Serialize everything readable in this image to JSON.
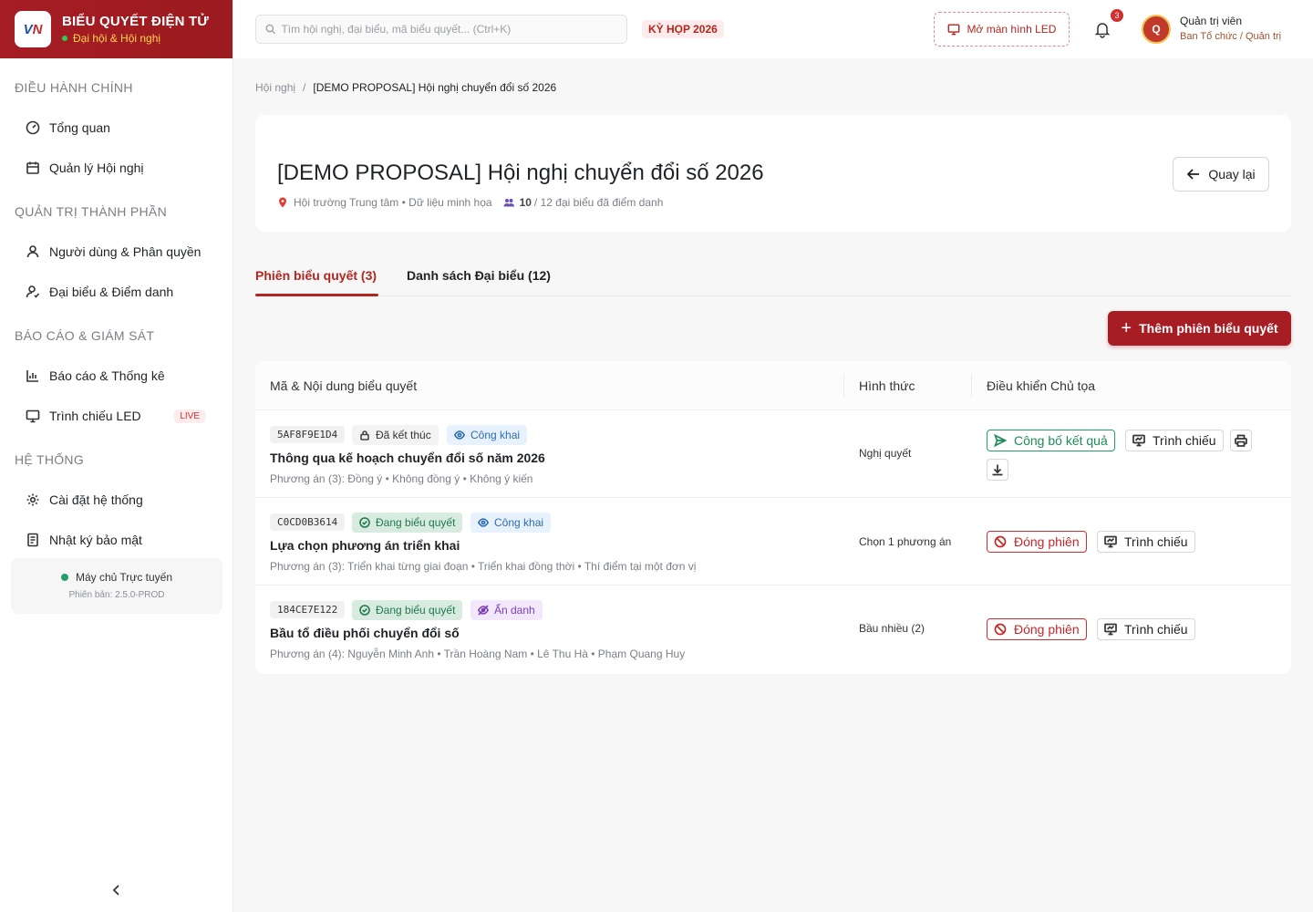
{
  "app": {
    "title": "BIỂU QUYẾT ĐIỆN TỬ",
    "subtitle": "Đại hội & Hội nghị",
    "logo_text_blue": "V",
    "logo_text_red": "N"
  },
  "sidebar": {
    "sections": [
      {
        "title": "ĐIỀU HÀNH CHÍNH",
        "items": [
          {
            "label": "Tổng quan",
            "icon": "dashboard-icon"
          },
          {
            "label": "Quản lý Hội nghị",
            "icon": "calendar-icon"
          }
        ]
      },
      {
        "title": "QUẢN TRỊ THÀNH PHẦN",
        "items": [
          {
            "label": "Người dùng & Phân quyền",
            "icon": "users-icon"
          },
          {
            "label": "Đại biểu & Điểm danh",
            "icon": "user-check-icon"
          }
        ]
      },
      {
        "title": "BÁO CÁO & GIÁM SÁT",
        "items": [
          {
            "label": "Báo cáo & Thống kê",
            "icon": "bar-chart-icon"
          },
          {
            "label": "Trình chiếu LED",
            "icon": "monitor-icon",
            "badge": "LIVE"
          }
        ]
      },
      {
        "title": "HỆ THỐNG",
        "items": [
          {
            "label": "Cài đặt hệ thống",
            "icon": "gear-icon"
          },
          {
            "label": "Nhật ký bảo mật",
            "icon": "log-icon"
          }
        ]
      }
    ],
    "server_status": "Máy chủ Trực tuyến",
    "version": "Phiên bản: 2.5.0-PROD"
  },
  "topbar": {
    "search_placeholder": "Tìm hội nghị, đại biểu, mã biểu quyết... (Ctrl+K)",
    "session_badge": "KỲ HỌP 2026",
    "led_button": "Mở màn hình LED",
    "notification_count": "3",
    "avatar_letter": "Q",
    "user_name": "Quản trị viên",
    "user_role": "Ban Tổ chức / Quản trị"
  },
  "breadcrumb": {
    "parent": "Hội nghị",
    "separator": "/",
    "current": "[DEMO PROPOSAL] Hội nghị chuyển đổi số 2026"
  },
  "conference": {
    "title": "[DEMO PROPOSAL] Hội nghị chuyển đổi số 2026",
    "location": "Hội trường Trung tâm • Dữ liệu minh họa",
    "attended": "10",
    "attendance_rest": "/ 12 đại biểu đã điểm danh",
    "back_button": "Quay lại"
  },
  "tabs": [
    {
      "label": "Phiên biểu quyết (3)",
      "active": true
    },
    {
      "label": "Danh sách Đại biểu (12)",
      "active": false
    }
  ],
  "add_button": "Thêm phiên biểu quyết",
  "table": {
    "headers": [
      "Mã & Nội dung biểu quyết",
      "Hình thức",
      "Điều khiển Chủ tọa"
    ],
    "rows": [
      {
        "code": "5AF8F9E1D4",
        "status": "Đã kết thúc",
        "visibility": "Công khai",
        "title": "Thông qua kế hoạch chuyển đổi số năm 2026",
        "options": "Phương án (3): Đồng ý • Không đồng ý • Không ý kiến",
        "form": "Nghị quyết",
        "controls": [
          "Công bố kết quả",
          "Trình chiếu"
        ]
      },
      {
        "code": "C0CD0B3614",
        "status": "Đang biểu quyết",
        "visibility": "Công khai",
        "title": "Lựa chọn phương án triển khai",
        "options": "Phương án (3): Triển khai từng giai đoạn • Triển khai đồng thời • Thí điểm tại một đơn vị",
        "form": "Chọn 1 phương án",
        "controls": [
          "Đóng phiên",
          "Trình chiếu"
        ]
      },
      {
        "code": "184CE7E122",
        "status": "Đang biểu quyết",
        "visibility": "Ẩn danh",
        "title": "Bầu tổ điều phối chuyển đổi số",
        "options": "Phương án (4): Nguyễn Minh Anh • Trần Hoàng Nam • Lê Thu Hà • Phạm Quang Huy",
        "form": "Bầu nhiều (2)",
        "controls": [
          "Đóng phiên",
          "Trình chiếu"
        ]
      }
    ]
  },
  "colors": {
    "brand": "#a61d24",
    "accent_gold": "#ffd54f",
    "success": "#22a06b",
    "danger": "#d32f2f",
    "info": "#2b6cb0",
    "anon": "#7b3fb0"
  }
}
